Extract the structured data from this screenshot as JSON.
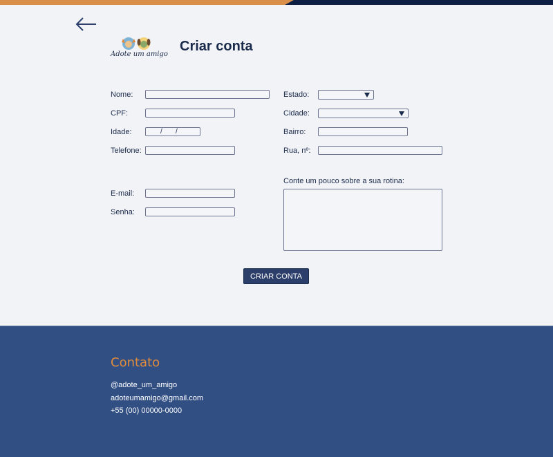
{
  "brand": {
    "logo_text": "Adote um amigo"
  },
  "page": {
    "title": "Criar conta"
  },
  "form": {
    "nome_label": "Nome:",
    "cpf_label": "CPF:",
    "idade_label": "Idade:",
    "telefone_label": "Telefone:",
    "email_label": "E-mail:",
    "senha_label": "Senha:",
    "estado_label": "Estado:",
    "cidade_label": "Cidade:",
    "bairro_label": "Bairro:",
    "rua_label": "Rua, nº:",
    "rotina_label": "Conte um pouco sobre a sua rotina:",
    "date_separator": "/",
    "submit_label": "CRIAR CONTA"
  },
  "footer": {
    "title": "Contato",
    "instagram": "@adote_um_amigo",
    "email": "adoteumamigo@gmail.com",
    "phone": "+55 (00) 00000-0000"
  },
  "colors": {
    "accent_orange": "#d98e4a",
    "navy": "#0d1f44",
    "button": "#2c3f6b",
    "footer_bg": "#324f84"
  }
}
